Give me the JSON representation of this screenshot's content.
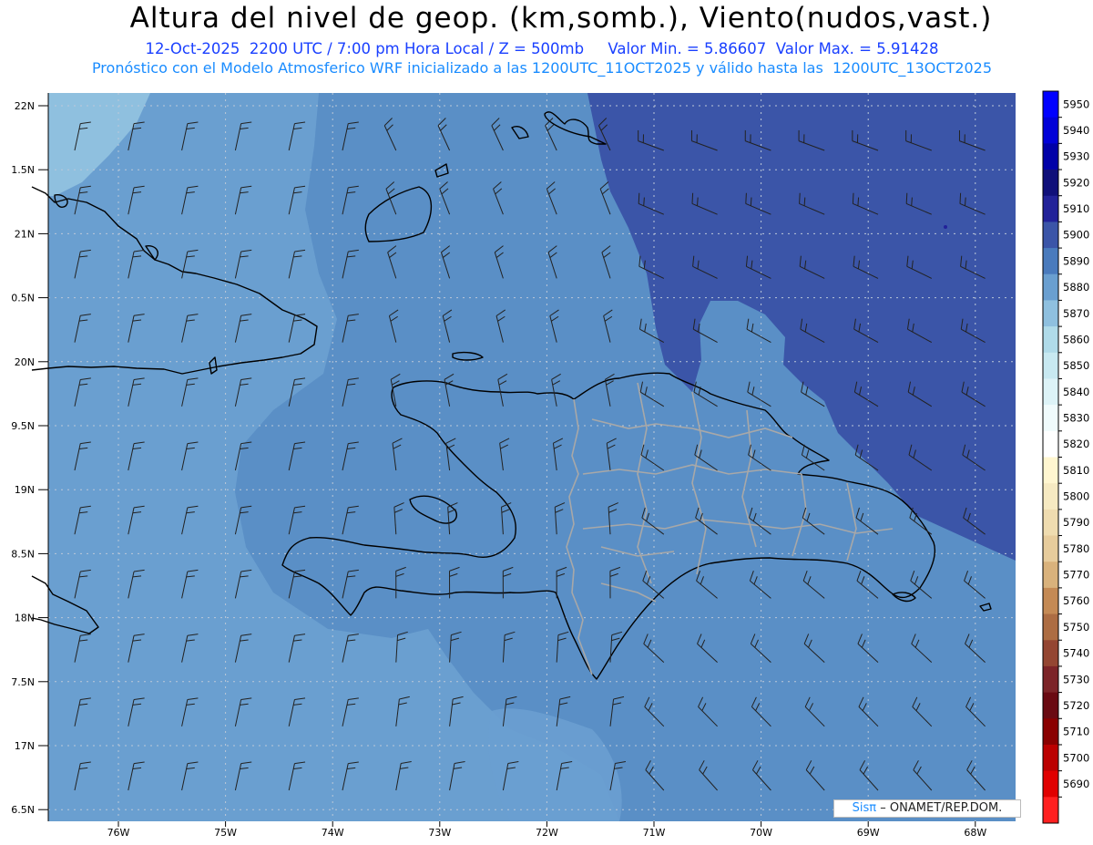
{
  "title": "Altura del nivel de geop. (km,somb.), Viento(nudos,vast.)",
  "subtitle_line1": {
    "date": "12-Oct-2025",
    "time": "2200 UTC / 7:00 pm Hora Local / Z = 500mb",
    "min": "Valor Min. = 5.86607",
    "max": "Valor Max. = 5.91428"
  },
  "subtitle_line2": "Pronóstico con el Modelo Atmosferico WRF inicializado a las 1200UTC_11OCT2025 y válido hasta las  1200UTC_13OCT2025",
  "credit": {
    "sis": "Sisπ",
    "rest": "– ONAMET/REP.DOM."
  },
  "lat_labels": [
    "22N",
    "1.5N",
    "21N",
    "0.5N",
    "20N",
    "9.5N",
    "19N",
    "8.5N",
    "18N",
    "7.5N",
    "17N",
    "6.5N"
  ],
  "lon_labels": [
    "76W",
    "75W",
    "74W",
    "73W",
    "72W",
    "71W",
    "70W",
    "69W",
    "68W"
  ],
  "colorbar": {
    "labels": [
      "5950",
      "5940",
      "5930",
      "5920",
      "5910",
      "5900",
      "5890",
      "5880",
      "5870",
      "5860",
      "5850",
      "5840",
      "5830",
      "5820",
      "5810",
      "5800",
      "5790",
      "5780",
      "5770",
      "5760",
      "5750",
      "5740",
      "5730",
      "5720",
      "5710",
      "5700",
      "5690"
    ],
    "colors": [
      "#0000ff",
      "#0000d8",
      "#0000a8",
      "#10107a",
      "#222299",
      "#3b55a8",
      "#4a7bbd",
      "#6a9fd0",
      "#8fc0df",
      "#b0dbe9",
      "#c8e9f1",
      "#ddf3f7",
      "#f0fbfc",
      "#ffffff",
      "#fff6d0",
      "#f6eac2",
      "#efdcb0",
      "#e7cc9c",
      "#d9b27c",
      "#c48a55",
      "#ad6d43",
      "#944632",
      "#7c2428",
      "#6a0a12",
      "#8a0000",
      "#bb0000",
      "#e00000",
      "#ff2020"
    ]
  }
}
